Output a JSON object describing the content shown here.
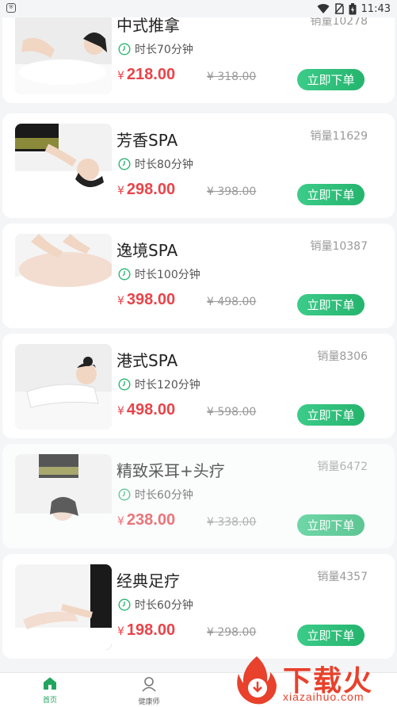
{
  "status_bar": {
    "time": "11:43"
  },
  "items": [
    {
      "name": "中式推拿",
      "sales": "销量10278",
      "duration": "时长70分钟",
      "currency": "¥",
      "price": "218.00",
      "old_price": "¥ 318.00",
      "button": "立即下单",
      "image": "chinese-massage-photo"
    },
    {
      "name": "芳香SPA",
      "sales": "销量11629",
      "duration": "时长80分钟",
      "currency": "¥",
      "price": "298.00",
      "old_price": "¥ 398.00",
      "button": "立即下单",
      "image": "aroma-spa-photo"
    },
    {
      "name": "逸境SPA",
      "sales": "销量10387",
      "duration": "时长100分钟",
      "currency": "¥",
      "price": "398.00",
      "old_price": "¥ 498.00",
      "button": "立即下单",
      "image": "abdomen-spa-photo"
    },
    {
      "name": "港式SPA",
      "sales": "销量8306",
      "duration": "时长120分钟",
      "currency": "¥",
      "price": "498.00",
      "old_price": "¥ 598.00",
      "button": "立即下单",
      "image": "hongkong-spa-photo"
    },
    {
      "name": "精致采耳+头疗",
      "sales": "销量6472",
      "duration": "时长60分钟",
      "currency": "¥",
      "price": "238.00",
      "old_price": "¥ 338.00",
      "button": "立即下单",
      "image": "ear-head-care-photo"
    },
    {
      "name": "经典足疗",
      "sales": "销量4357",
      "duration": "时长60分钟",
      "currency": "¥",
      "price": "198.00",
      "old_price": "¥ 298.00",
      "button": "立即下单",
      "image": "foot-massage-photo"
    }
  ],
  "tab_bar": {
    "tabs": [
      {
        "label": "首页",
        "icon": "home-icon",
        "active": true
      },
      {
        "label": "健康师",
        "icon": "person-icon",
        "active": false
      }
    ]
  },
  "watermark": {
    "brand": "下载火",
    "url": "xiazaihuo.com"
  },
  "colors": {
    "accent": "#25b46d",
    "price": "#e84449",
    "brand_watermark": "#e8412c"
  }
}
